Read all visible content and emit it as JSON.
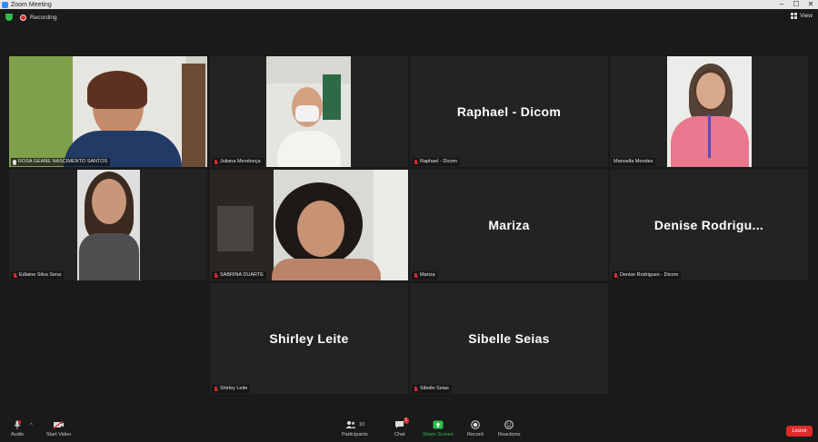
{
  "window": {
    "title": "Zoom Meeting"
  },
  "topbar": {
    "recording_label": "Recording",
    "view_label": "View"
  },
  "tiles": [
    {
      "name": "ROSA GEANE NASCIMENTO SANTOS",
      "muted": false,
      "active_speaker": true,
      "video": true
    },
    {
      "name": "Juliana Mendonça",
      "muted": true,
      "video": true
    },
    {
      "name": "Raphael - Dicom",
      "display_name": "Raphael - Dicom",
      "muted": true,
      "video": false
    },
    {
      "name": "Manoella Mendes",
      "muted": false,
      "video": true
    },
    {
      "name": "Edlaine Silva Sena",
      "muted": true,
      "video": true
    },
    {
      "name": "SABRINA DUARTE",
      "muted": true,
      "video": true
    },
    {
      "name": "Mariza",
      "display_name": "Mariza",
      "muted": true,
      "video": false
    },
    {
      "name": "Denise Rodrigues - Dicom",
      "display_name": "Denise Rodrigu...",
      "muted": true,
      "video": false
    },
    {
      "name": "Shirley Leite",
      "display_name": "Shirley Leite",
      "muted": true,
      "video": false
    },
    {
      "name": "Sibelle Seias",
      "display_name": "Sibelle Seias",
      "muted": true,
      "video": false
    }
  ],
  "toolbar": {
    "audio_label": "Audio",
    "start_video_label": "Start Video",
    "participants_label": "Participants",
    "participants_count": "10",
    "chat_label": "Chat",
    "chat_badge": "1",
    "share_screen_label": "Share Screen",
    "record_label": "Record",
    "reactions_label": "Reactions",
    "leave_label": "Leave"
  },
  "colors": {
    "active_speaker": "#e8f05a",
    "share_green": "#2fbd52",
    "leave_red": "#e02828"
  }
}
